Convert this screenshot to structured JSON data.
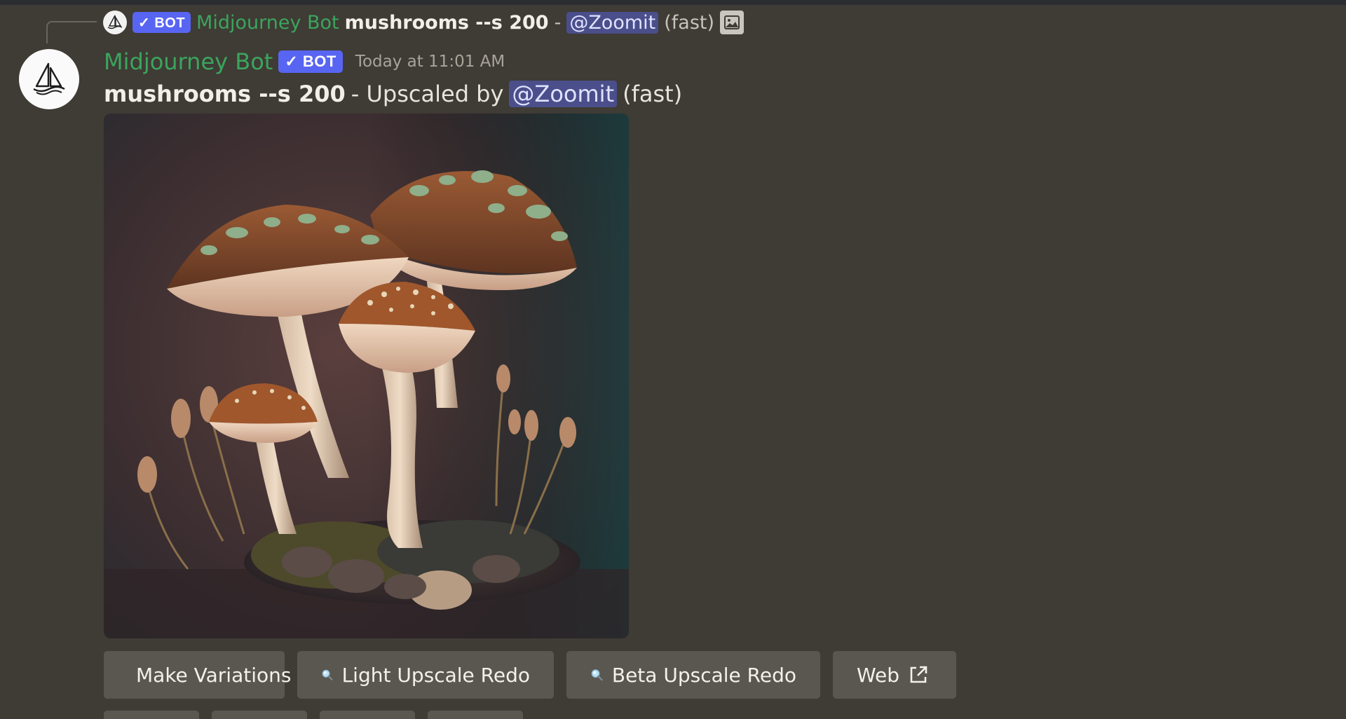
{
  "reply": {
    "bot_badge": "✓ BOT",
    "bot_name": "Midjourney Bot",
    "prompt": "mushrooms --s 200",
    "separator": "-",
    "mention": "@Zoomit",
    "speed": "(fast)"
  },
  "message": {
    "author": "Midjourney Bot",
    "bot_badge": "✓ BOT",
    "timestamp": "Today at 11:01 AM",
    "prompt": "mushrooms --s 200",
    "upscaled_text": "- Upscaled by",
    "mention": "@Zoomit",
    "speed": "(fast)"
  },
  "buttons": [
    {
      "label": "Make Variations",
      "icon": "magic-wand-icon"
    },
    {
      "label": "Light Upscale Redo",
      "icon": "magnifier-icon"
    },
    {
      "label": "Beta Upscale Redo",
      "icon": "magnifier-icon"
    },
    {
      "label": "Web",
      "icon": "external-link-icon"
    }
  ],
  "colors": {
    "background": "#3f3b35",
    "bot_green": "#3ba55d",
    "badge_blurple": "#5865f2",
    "button_bg": "#5a5750"
  }
}
